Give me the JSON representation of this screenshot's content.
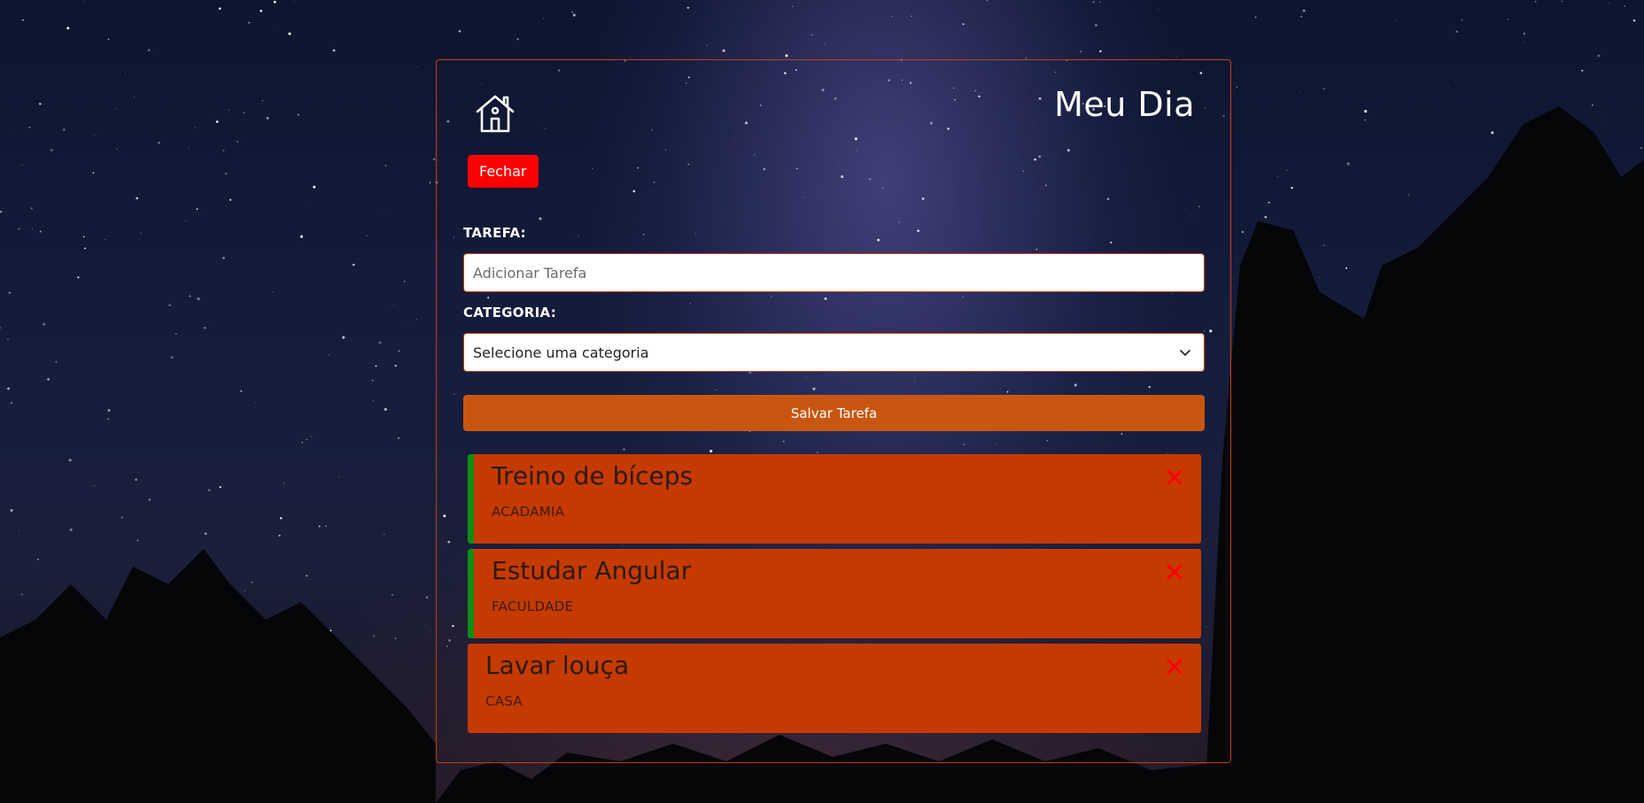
{
  "app": {
    "title": "Meu Dia",
    "close_label": "Fechar",
    "home_icon": "home-icon"
  },
  "form": {
    "task_label": "TAREFA:",
    "task_placeholder": "Adicionar Tarefa",
    "task_value": "",
    "category_label": "CATEGORIA:",
    "category_selected": "Selecione uma categoria",
    "save_label": "Salvar Tarefa"
  },
  "tasks": [
    {
      "title": "Treino de bíceps",
      "category": "ACADAMIA",
      "accent": true,
      "delete_icon": "close-icon"
    },
    {
      "title": "Estudar Angular",
      "category": "FACULDADE",
      "accent": true,
      "delete_icon": "close-icon"
    },
    {
      "title": "Lavar louça",
      "category": "CASA",
      "accent": false,
      "delete_icon": "close-icon"
    }
  ],
  "colors": {
    "panel_border": "#c2410c",
    "close_button": "#ff0000",
    "save_button": "#c95610",
    "task_card": "#c53a00",
    "task_accent": "#148c14",
    "delete_icon": "#ff0000"
  }
}
